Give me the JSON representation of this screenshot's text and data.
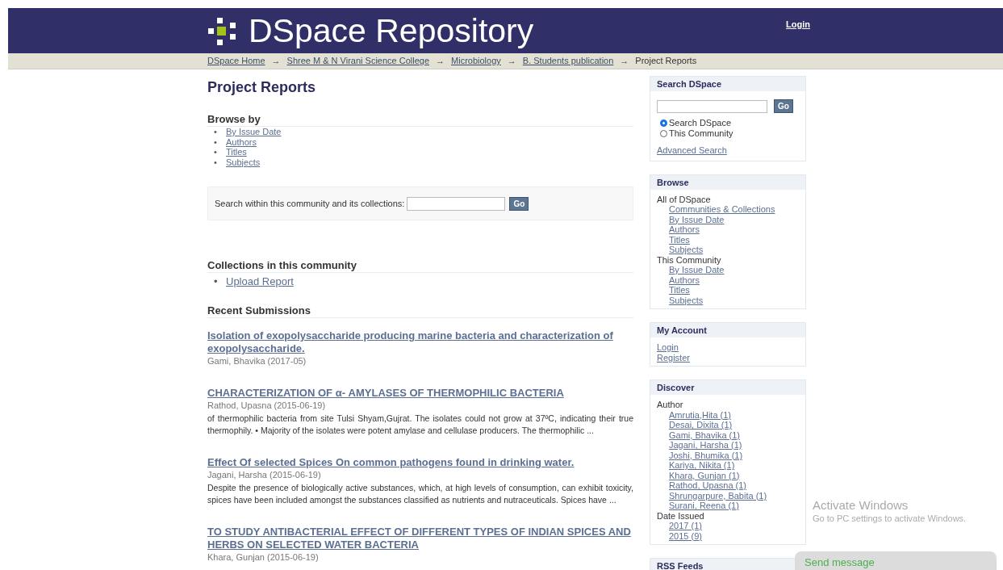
{
  "header": {
    "title": "DSpace Repository",
    "login": "Login"
  },
  "breadcrumbs": [
    {
      "label": "DSpace Home",
      "link": true
    },
    {
      "label": "Shree M & N Virani Science College",
      "link": true
    },
    {
      "label": "Microbiology",
      "link": true
    },
    {
      "label": "B. Students publication",
      "link": true
    },
    {
      "label": "Project Reports",
      "link": false
    }
  ],
  "breadcrumb_separator": "→",
  "page_title": "Project Reports",
  "list_bullet": "•",
  "browse_by": {
    "heading": "Browse by",
    "items": [
      "By Issue Date",
      "Authors",
      "Titles",
      "Subjects"
    ]
  },
  "community_search": {
    "label": "Search within this community and its collections:",
    "button": "Go"
  },
  "collections": {
    "heading": "Collections in this community",
    "items": [
      "Upload Report"
    ]
  },
  "recent": {
    "heading": "Recent Submissions",
    "items": [
      {
        "title": "Isolation of exopolysaccharide producing marine bacteria and characterization of exopolysaccharide.",
        "author": "Gami, Bhavika",
        "date": "(2017-05)"
      },
      {
        "title": "CHARACTERIZATION OF α- AMYLASES OF THERMOPHILIC BACTERIA",
        "author": "Rathod, Upasna",
        "date": "(2015-06-19)",
        "abstract": "of thermophilic bacteria from site Tulsi Shyam,Gujrat. The isolates could not grow at 37ºC, indicating their true thermophily. • Majority of the isolates were potent amylase and cellulase producers. The thermophilic ..."
      },
      {
        "title": "Effect Of selected Spices On common pathogens found in drinking water.",
        "author": "Jagani, Harsha",
        "date": "(2015-06-19)",
        "abstract": "Despite the presence of biologically active substances, which, at high levels of consumption, can exhibit toxicity, spices have been included amongst the substances classified as nutrients and nutraceuticals. Spices have ..."
      },
      {
        "title": "TO STUDY ANTIBACTERIAL EFFECT OF DIFFERENT TYPES OF INDIAN SPICES AND HERBS ON SELECTED WATER BACTERIA",
        "author": "Khara, Gunjan",
        "date": "(2015-06-19)"
      }
    ]
  },
  "sidebar": {
    "search": {
      "heading": "Search DSpace",
      "button": "Go",
      "options": [
        {
          "label": "Search DSpace",
          "selected": true
        },
        {
          "label": "This Community",
          "selected": false
        }
      ],
      "advanced": "Advanced Search"
    },
    "browse": {
      "heading": "Browse",
      "groups": [
        {
          "label": "All of DSpace",
          "links": [
            "Communities & Collections",
            "By Issue Date",
            "Authors",
            "Titles",
            "Subjects"
          ]
        },
        {
          "label": "This Community",
          "links": [
            "By Issue Date",
            "Authors",
            "Titles",
            "Subjects"
          ]
        }
      ]
    },
    "account": {
      "heading": "My Account",
      "links": [
        "Login",
        "Register"
      ]
    },
    "discover": {
      "heading": "Discover",
      "groups": [
        {
          "label": "Author",
          "links": [
            "Amrutia,Hita (1)",
            "Desai, Dixita (1)",
            "Gami, Bhavika (1)",
            "Jagani, Harsha (1)",
            "Joshi, Bhumika (1)",
            "Kariya, Nikita (1)",
            "Khara, Gunjan (1)",
            "Rathod, Upasna (1)",
            "Shrungarpure, Babita (1)",
            "Surani, Reena (1)"
          ]
        },
        {
          "label": "Date Issued",
          "links": [
            "2017 (1)",
            "2015 (9)"
          ]
        }
      ]
    },
    "rss": {
      "heading": "RSS Feeds"
    }
  },
  "os_notice": {
    "title": "Activate Windows",
    "text": "Go to PC settings to activate Windows."
  },
  "chat_widget": {
    "label": "Send message"
  }
}
